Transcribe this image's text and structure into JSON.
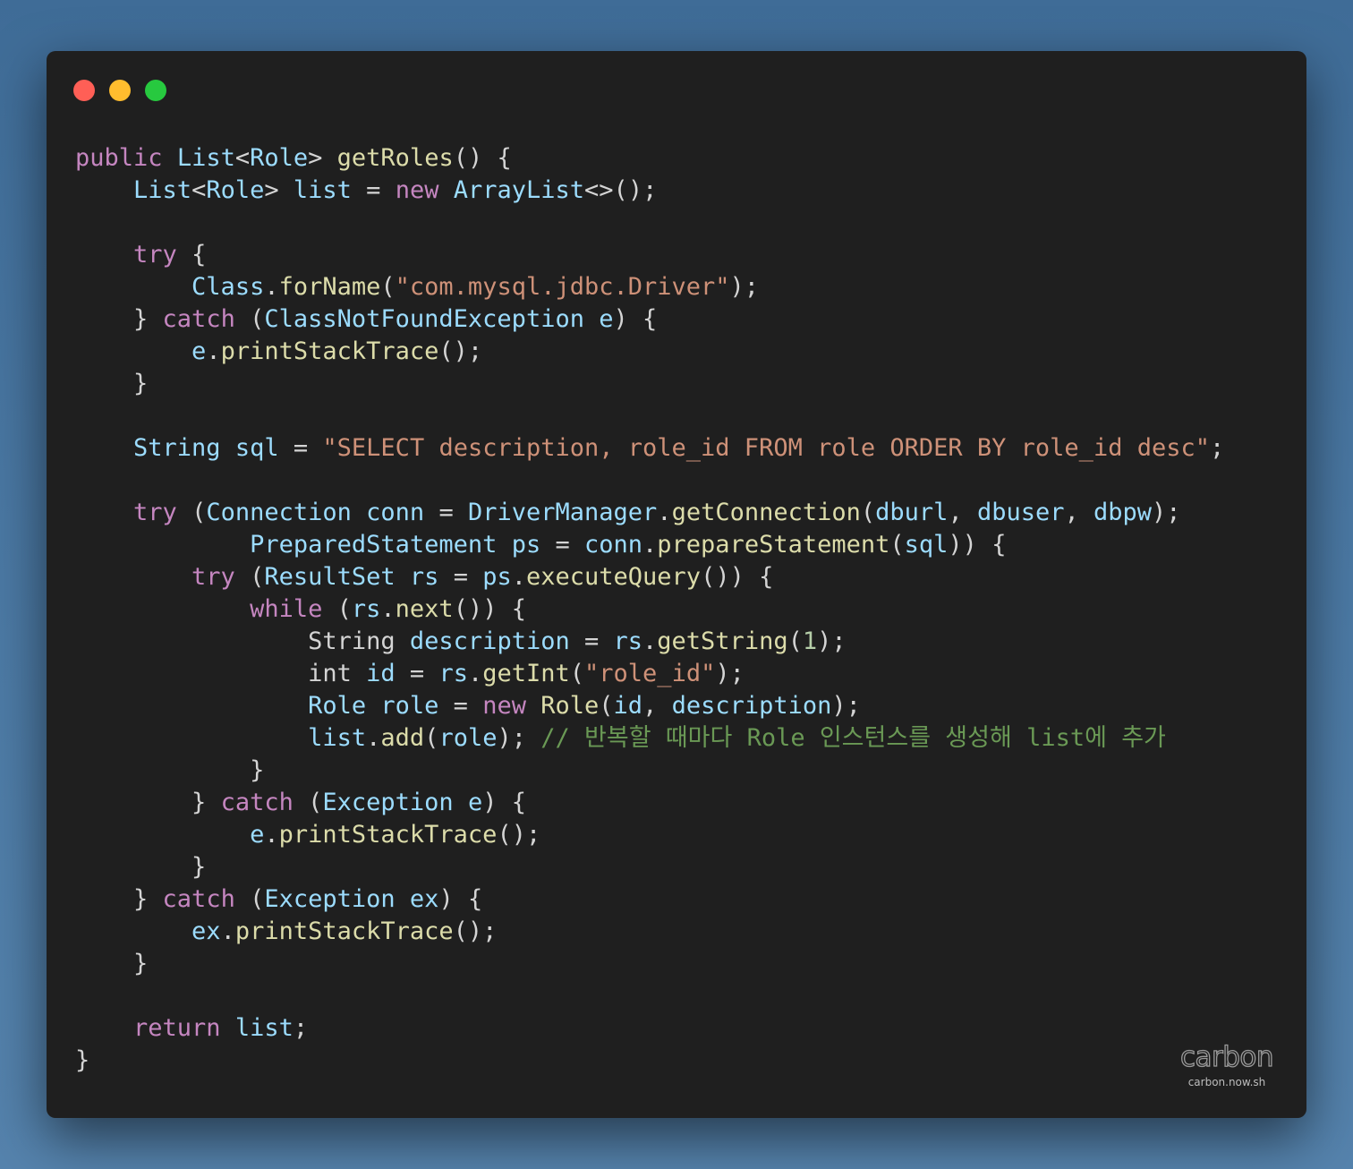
{
  "colors": {
    "close": "#ff5f56",
    "minimize": "#ffbd2e",
    "maximize": "#27c93f",
    "editor_background": "#1f1f1f"
  },
  "window_controls": [
    {
      "name": "close",
      "icon": "red-circle-icon"
    },
    {
      "name": "minimize",
      "icon": "yellow-circle-icon"
    },
    {
      "name": "maximize",
      "icon": "green-circle-icon"
    }
  ],
  "code_lines": [
    [
      [
        "keyword",
        "public"
      ],
      [
        "plain",
        " "
      ],
      [
        "type",
        "List"
      ],
      [
        "plain",
        "<"
      ],
      [
        "type",
        "Role"
      ],
      [
        "plain",
        "> "
      ],
      [
        "fn",
        "getRoles"
      ],
      [
        "plain",
        "() {"
      ]
    ],
    [
      [
        "plain",
        "    "
      ],
      [
        "type",
        "List"
      ],
      [
        "plain",
        "<"
      ],
      [
        "type",
        "Role"
      ],
      [
        "plain",
        "> "
      ],
      [
        "var",
        "list"
      ],
      [
        "plain",
        " = "
      ],
      [
        "keyword",
        "new"
      ],
      [
        "plain",
        " "
      ],
      [
        "type",
        "ArrayList"
      ],
      [
        "plain",
        "<>();"
      ]
    ],
    [],
    [
      [
        "plain",
        "    "
      ],
      [
        "keyword",
        "try"
      ],
      [
        "plain",
        " {"
      ]
    ],
    [
      [
        "plain",
        "        "
      ],
      [
        "type",
        "Class"
      ],
      [
        "plain",
        "."
      ],
      [
        "fn",
        "forName"
      ],
      [
        "plain",
        "("
      ],
      [
        "string",
        "\"com.mysql.jdbc.Driver\""
      ],
      [
        "plain",
        ");"
      ]
    ],
    [
      [
        "plain",
        "    } "
      ],
      [
        "keyword",
        "catch"
      ],
      [
        "plain",
        " ("
      ],
      [
        "type",
        "ClassNotFoundException"
      ],
      [
        "plain",
        " "
      ],
      [
        "var",
        "e"
      ],
      [
        "plain",
        ") {"
      ]
    ],
    [
      [
        "plain",
        "        "
      ],
      [
        "var",
        "e"
      ],
      [
        "plain",
        "."
      ],
      [
        "fn",
        "printStackTrace"
      ],
      [
        "plain",
        "();"
      ]
    ],
    [
      [
        "plain",
        "    }"
      ]
    ],
    [],
    [
      [
        "plain",
        "    "
      ],
      [
        "type",
        "String"
      ],
      [
        "plain",
        " "
      ],
      [
        "var",
        "sql"
      ],
      [
        "plain",
        " = "
      ],
      [
        "string",
        "\"SELECT description, role_id FROM role ORDER BY role_id desc\""
      ],
      [
        "plain",
        ";"
      ]
    ],
    [],
    [
      [
        "plain",
        "    "
      ],
      [
        "keyword",
        "try"
      ],
      [
        "plain",
        " ("
      ],
      [
        "type",
        "Connection"
      ],
      [
        "plain",
        " "
      ],
      [
        "var",
        "conn"
      ],
      [
        "plain",
        " = "
      ],
      [
        "type",
        "DriverManager"
      ],
      [
        "plain",
        "."
      ],
      [
        "fn",
        "getConnection"
      ],
      [
        "plain",
        "("
      ],
      [
        "var",
        "dburl"
      ],
      [
        "plain",
        ", "
      ],
      [
        "var",
        "dbuser"
      ],
      [
        "plain",
        ", "
      ],
      [
        "var",
        "dbpw"
      ],
      [
        "plain",
        ");"
      ]
    ],
    [
      [
        "plain",
        "            "
      ],
      [
        "type",
        "PreparedStatement"
      ],
      [
        "plain",
        " "
      ],
      [
        "var",
        "ps"
      ],
      [
        "plain",
        " = "
      ],
      [
        "var",
        "conn"
      ],
      [
        "plain",
        "."
      ],
      [
        "fn",
        "prepareStatement"
      ],
      [
        "plain",
        "("
      ],
      [
        "var",
        "sql"
      ],
      [
        "plain",
        ")) {"
      ]
    ],
    [
      [
        "plain",
        "        "
      ],
      [
        "keyword",
        "try"
      ],
      [
        "plain",
        " ("
      ],
      [
        "type",
        "ResultSet"
      ],
      [
        "plain",
        " "
      ],
      [
        "var",
        "rs"
      ],
      [
        "plain",
        " = "
      ],
      [
        "var",
        "ps"
      ],
      [
        "plain",
        "."
      ],
      [
        "fn",
        "executeQuery"
      ],
      [
        "plain",
        "()) {"
      ]
    ],
    [
      [
        "plain",
        "            "
      ],
      [
        "keyword",
        "while"
      ],
      [
        "plain",
        " ("
      ],
      [
        "var",
        "rs"
      ],
      [
        "plain",
        "."
      ],
      [
        "fn",
        "next"
      ],
      [
        "plain",
        "()) {"
      ]
    ],
    [
      [
        "plain",
        "                "
      ],
      [
        "plain",
        "String"
      ],
      [
        "plain",
        " "
      ],
      [
        "var",
        "description"
      ],
      [
        "plain",
        " = "
      ],
      [
        "var",
        "rs"
      ],
      [
        "plain",
        "."
      ],
      [
        "fn",
        "getString"
      ],
      [
        "plain",
        "("
      ],
      [
        "number",
        "1"
      ],
      [
        "plain",
        ");"
      ]
    ],
    [
      [
        "plain",
        "                "
      ],
      [
        "plain",
        "int"
      ],
      [
        "plain",
        " "
      ],
      [
        "var",
        "id"
      ],
      [
        "plain",
        " = "
      ],
      [
        "var",
        "rs"
      ],
      [
        "plain",
        "."
      ],
      [
        "fn",
        "getInt"
      ],
      [
        "plain",
        "("
      ],
      [
        "string",
        "\"role_id\""
      ],
      [
        "plain",
        ");"
      ]
    ],
    [
      [
        "plain",
        "                "
      ],
      [
        "type",
        "Role"
      ],
      [
        "plain",
        " "
      ],
      [
        "var",
        "role"
      ],
      [
        "plain",
        " = "
      ],
      [
        "keyword",
        "new"
      ],
      [
        "plain",
        " "
      ],
      [
        "fn",
        "Role"
      ],
      [
        "plain",
        "("
      ],
      [
        "var",
        "id"
      ],
      [
        "plain",
        ", "
      ],
      [
        "var",
        "description"
      ],
      [
        "plain",
        ");"
      ]
    ],
    [
      [
        "plain",
        "                "
      ],
      [
        "var",
        "list"
      ],
      [
        "plain",
        "."
      ],
      [
        "fn",
        "add"
      ],
      [
        "plain",
        "("
      ],
      [
        "var",
        "role"
      ],
      [
        "plain",
        "); "
      ],
      [
        "comment",
        "// 반복할 때마다 Role 인스턴스를 생성해 list에 추가"
      ]
    ],
    [
      [
        "plain",
        "            }"
      ]
    ],
    [
      [
        "plain",
        "        } "
      ],
      [
        "keyword",
        "catch"
      ],
      [
        "plain",
        " ("
      ],
      [
        "type",
        "Exception"
      ],
      [
        "plain",
        " "
      ],
      [
        "var",
        "e"
      ],
      [
        "plain",
        ") {"
      ]
    ],
    [
      [
        "plain",
        "            "
      ],
      [
        "var",
        "e"
      ],
      [
        "plain",
        "."
      ],
      [
        "fn",
        "printStackTrace"
      ],
      [
        "plain",
        "();"
      ]
    ],
    [
      [
        "plain",
        "        }"
      ]
    ],
    [
      [
        "plain",
        "    } "
      ],
      [
        "keyword",
        "catch"
      ],
      [
        "plain",
        " ("
      ],
      [
        "type",
        "Exception"
      ],
      [
        "plain",
        " "
      ],
      [
        "var",
        "ex"
      ],
      [
        "plain",
        ") {"
      ]
    ],
    [
      [
        "plain",
        "        "
      ],
      [
        "var",
        "ex"
      ],
      [
        "plain",
        "."
      ],
      [
        "fn",
        "printStackTrace"
      ],
      [
        "plain",
        "();"
      ]
    ],
    [
      [
        "plain",
        "    }"
      ]
    ],
    [],
    [
      [
        "plain",
        "    "
      ],
      [
        "keyword",
        "return"
      ],
      [
        "plain",
        " "
      ],
      [
        "var",
        "list"
      ],
      [
        "plain",
        ";"
      ]
    ],
    [
      [
        "plain",
        "}"
      ]
    ]
  ],
  "watermark": {
    "logo": "carbon",
    "url": "carbon.now.sh"
  }
}
